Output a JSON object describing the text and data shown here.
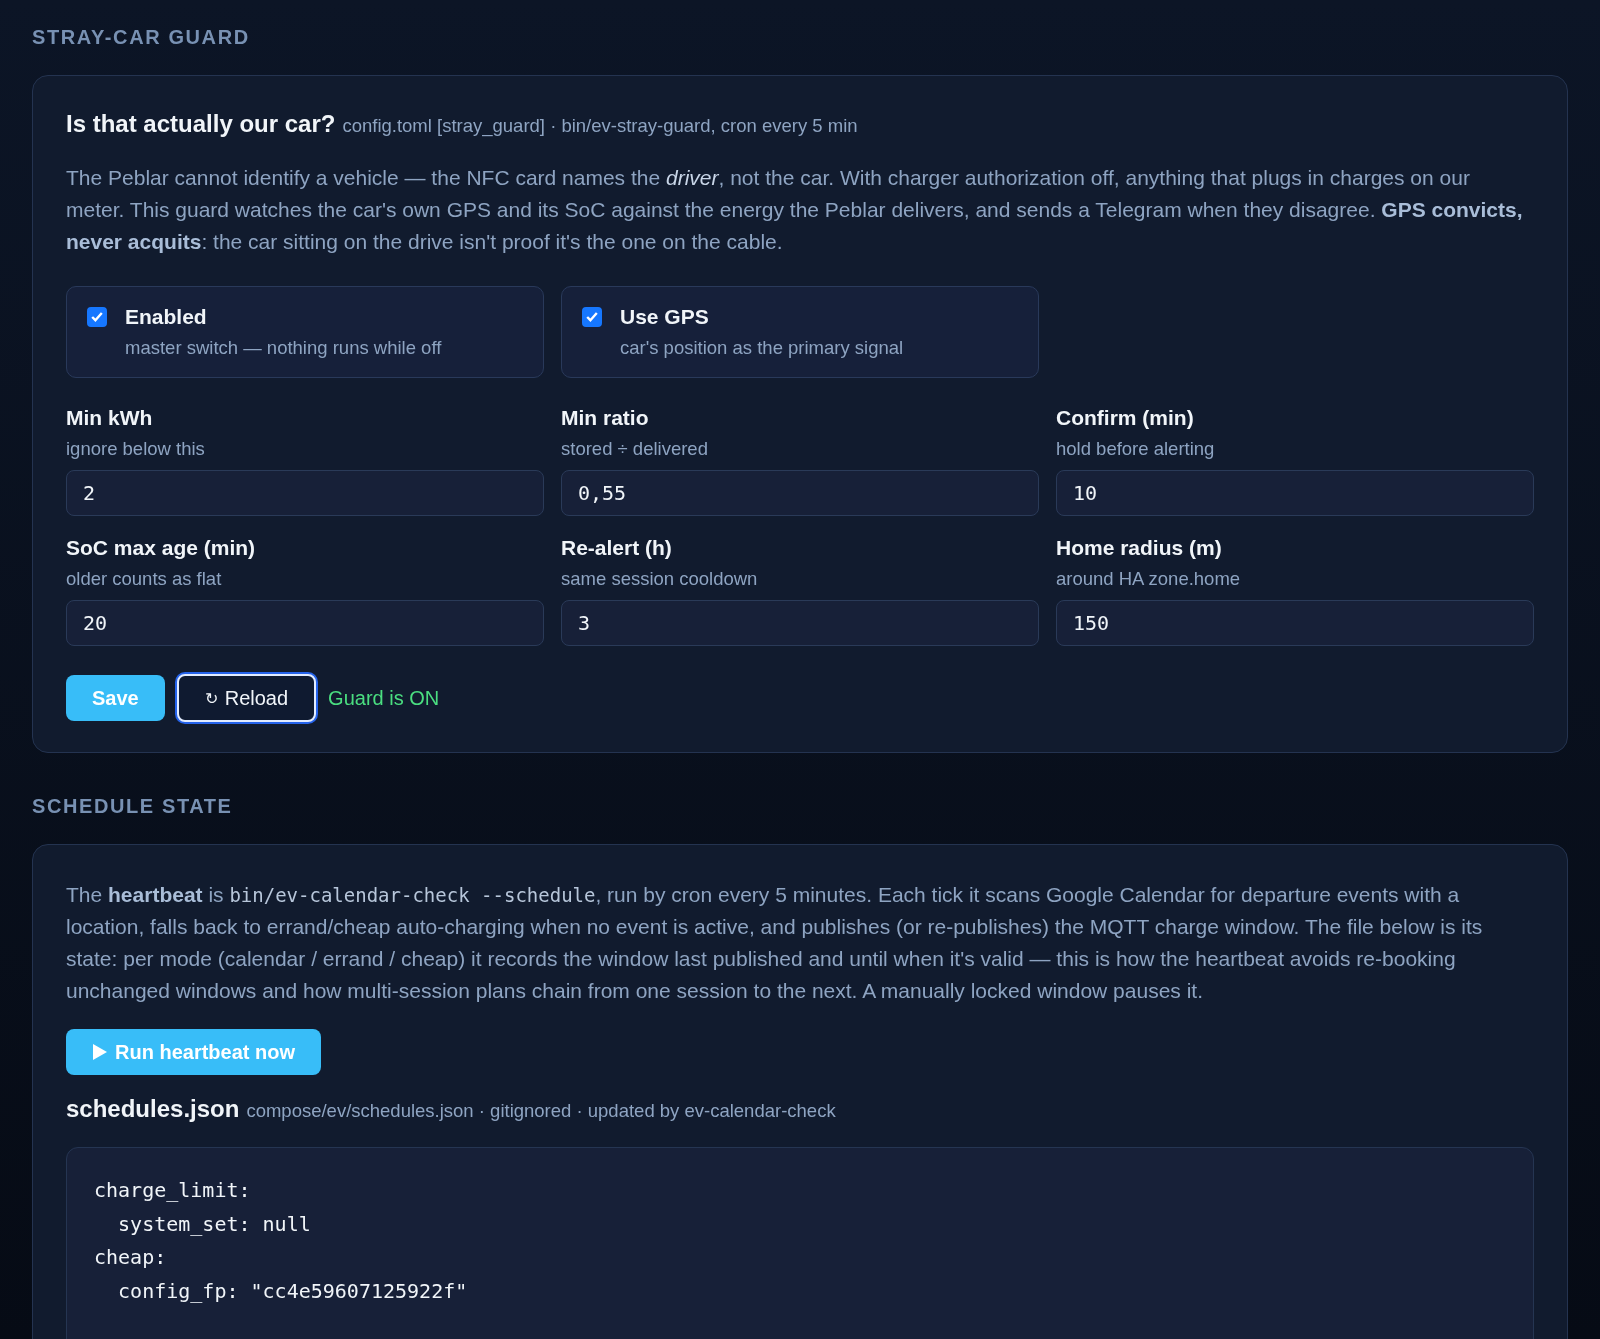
{
  "guard": {
    "heading": "STRAY-CAR GUARD",
    "title": "Is that actually our car?",
    "subtitle": "config.toml [stray_guard] · bin/ev-stray-guard, cron every 5 min",
    "intro": "The Peblar cannot identify a vehicle — the NFC card names the *driver*, not the car. With charger authorization off, anything that plugs in charges on our meter. This guard watches the car's own GPS and its SoC against the energy the Peblar delivers, and sends a Telegram when they disagree. **GPS convicts, never acquits**: the car sitting on the drive isn't proof it's the one on the cable.",
    "toggles": [
      {
        "label": "Enabled",
        "hint": "master switch — nothing runs while off",
        "checked": true
      },
      {
        "label": "Use GPS",
        "hint": "car's position as the primary signal",
        "checked": true
      }
    ],
    "fields": [
      {
        "label": "Min kWh",
        "hint": "ignore below this",
        "value": "2"
      },
      {
        "label": "Min ratio",
        "hint": "stored ÷ delivered",
        "value": "0,55"
      },
      {
        "label": "Confirm (min)",
        "hint": "hold before alerting",
        "value": "10"
      },
      {
        "label": "SoC max age (min)",
        "hint": "older counts as flat",
        "value": "20"
      },
      {
        "label": "Re-alert (h)",
        "hint": "same session cooldown",
        "value": "3"
      },
      {
        "label": "Home radius (m)",
        "hint": "around HA zone.home",
        "value": "150"
      }
    ],
    "save": "Save",
    "reload_icon": "↻",
    "reload": "Reload",
    "status": "Guard is ON"
  },
  "schedule": {
    "heading": "SCHEDULE STATE",
    "segments": [
      {
        "kind": "text",
        "text": "The **heartbeat** is "
      },
      {
        "kind": "code",
        "text": "bin/ev-calendar-check --schedule"
      },
      {
        "kind": "text",
        "text": ", run by cron every 5 minutes. Each tick it scans Google Calendar for departure events with a location, falls back to errand/cheap auto-charging when no event is active, and publishes (or re-publishes) the MQTT charge window. The file below is its state: per mode (calendar / errand / cheap) it records the window last published and until when it's valid — this is how the heartbeat avoids re-booking unchanged windows and how multi-session plans chain from one session to the next. A manually locked window pauses it."
      }
    ],
    "run_button": "Run heartbeat now",
    "file_title": "schedules.json",
    "file_meta": "compose/ev/schedules.json · gitignored · updated by ev-calendar-check",
    "code_lines": [
      "charge_limit:",
      "  system_set: null",
      "cheap:",
      "  config_fp: \"cc4e59607125922f\""
    ]
  }
}
